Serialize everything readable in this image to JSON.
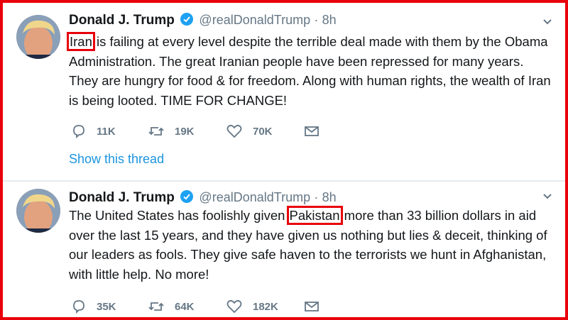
{
  "tweets": [
    {
      "author": "Donald J. Trump",
      "handle": "@realDonaldTrump",
      "separator": "·",
      "time": "8h",
      "text_before": "",
      "highlight": "Iran",
      "text_after": " is failing at every level despite the terrible deal made with them by the Obama Administration. The great Iranian people have been repressed for many years. They are hungry for food & for freedom. Along with human rights, the wealth of Iran is being looted. TIME FOR CHANGE!",
      "replies": "11K",
      "retweets": "19K",
      "likes": "70K",
      "show_thread": "Show this thread"
    },
    {
      "author": "Donald J. Trump",
      "handle": "@realDonaldTrump",
      "separator": "·",
      "time": "8h",
      "text_before": "The United States has foolishly given ",
      "highlight": "Pakistan",
      "text_after": " more than 33 billion dollars in aid over the last 15 years, and they have given us nothing but lies & deceit, thinking of our leaders as fools. They give safe haven to the terrorists we hunt in Afghanistan, with little help. No more!",
      "replies": "35K",
      "retweets": "64K",
      "likes": "182K"
    }
  ],
  "colors": {
    "highlight_box": "#e8000b",
    "link": "#1b95e0",
    "muted": "#657786",
    "verified": "#1da1f2"
  }
}
